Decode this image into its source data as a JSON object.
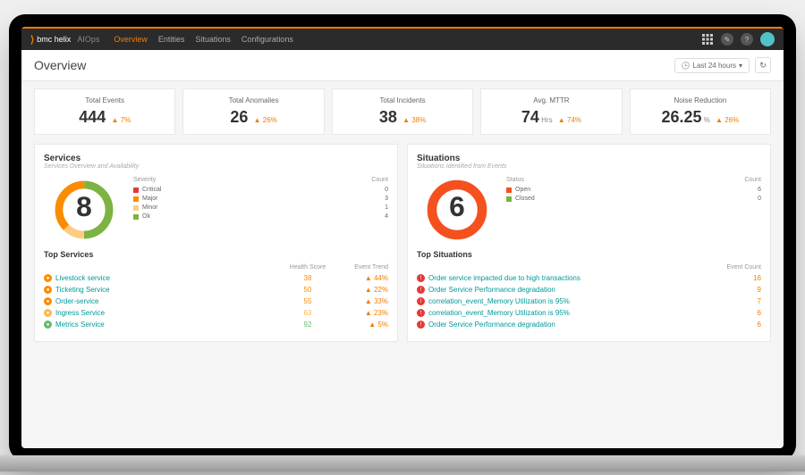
{
  "brand": {
    "logo": "⟩",
    "main": "bmc helix",
    "sub": "AIOps"
  },
  "nav": [
    {
      "label": "Overview",
      "active": true
    },
    {
      "label": "Entities",
      "active": false
    },
    {
      "label": "Situations",
      "active": false
    },
    {
      "label": "Configurations",
      "active": false
    }
  ],
  "page_title": "Overview",
  "time_filter": {
    "icon": "🕒",
    "label": "Last 24 hours",
    "caret": "▾"
  },
  "refresh_icon": "↻",
  "kpis": [
    {
      "label": "Total Events",
      "value": "444",
      "unit": "",
      "delta": "▲ 7%"
    },
    {
      "label": "Total Anomalies",
      "value": "26",
      "unit": "",
      "delta": "▲ 26%"
    },
    {
      "label": "Total Incidents",
      "value": "38",
      "unit": "",
      "delta": "▲ 38%"
    },
    {
      "label": "Avg. MTTR",
      "value": "74",
      "unit": "Hrs",
      "delta": "▲ 74%"
    },
    {
      "label": "Noise Reduction",
      "value": "26.25",
      "unit": "%",
      "delta": "▲ 26%"
    }
  ],
  "services": {
    "title": "Services",
    "subtitle": "Services Overview and Availability",
    "donut_center": "8",
    "legend_headers": {
      "left": "Severity",
      "right": "Count"
    },
    "legend": [
      {
        "label": "Critical",
        "count": "0",
        "color": "#e53935"
      },
      {
        "label": "Major",
        "count": "3",
        "color": "#fb8c00"
      },
      {
        "label": "Minor",
        "count": "1",
        "color": "#ffcc80"
      },
      {
        "label": "Ok",
        "count": "4",
        "color": "#7cb342"
      }
    ],
    "top_title": "Top Services",
    "columns": {
      "c1": "",
      "c2": "Health Score",
      "c3": "Event Trend"
    },
    "rows": [
      {
        "icon_color": "#fb8c00",
        "name": "Livestock service",
        "health": "38",
        "trend": "▲ 44%"
      },
      {
        "icon_color": "#fb8c00",
        "name": "Ticketing Service",
        "health": "50",
        "trend": "▲ 22%"
      },
      {
        "icon_color": "#fb8c00",
        "name": "Order-service",
        "health": "55",
        "trend": "▲ 33%"
      },
      {
        "icon_color": "#ffb74d",
        "name": "Ingress Service",
        "health": "63",
        "trend": "▲ 23%"
      },
      {
        "icon_color": "#66bb6a",
        "name": "Metrics Service",
        "health": "92",
        "trend": "▲ 5%"
      }
    ]
  },
  "situations": {
    "title": "Situations",
    "subtitle": "Situations Identified from Events",
    "donut_center": "6",
    "legend_headers": {
      "left": "Status",
      "right": "Count"
    },
    "legend": [
      {
        "label": "Open",
        "count": "6",
        "color": "#f4511e"
      },
      {
        "label": "Closed",
        "count": "0",
        "color": "#7cb342"
      }
    ],
    "top_title": "Top Situations",
    "columns": {
      "c1": "",
      "c2": "Event Count"
    },
    "rows": [
      {
        "icon_color": "#e53935",
        "name": "Order service impacted due to high transactions",
        "count": "16"
      },
      {
        "icon_color": "#e53935",
        "name": "Order Service Performance degradation",
        "count": "9"
      },
      {
        "icon_color": "#e53935",
        "name": "correlation_event_Memory Utilization is 95%",
        "count": "7"
      },
      {
        "icon_color": "#e53935",
        "name": "correlation_event_Memory Utilization is 95%",
        "count": "6"
      },
      {
        "icon_color": "#e53935",
        "name": "Order Service Performance degradation",
        "count": "6"
      }
    ]
  },
  "chart_data": [
    {
      "type": "pie",
      "title": "Services by Severity",
      "categories": [
        "Critical",
        "Major",
        "Minor",
        "Ok"
      ],
      "values": [
        0,
        3,
        1,
        4
      ],
      "colors": [
        "#e53935",
        "#fb8c00",
        "#ffcc80",
        "#7cb342"
      ]
    },
    {
      "type": "pie",
      "title": "Situations by Status",
      "categories": [
        "Open",
        "Closed"
      ],
      "values": [
        6,
        0
      ],
      "colors": [
        "#f4511e",
        "#7cb342"
      ]
    }
  ]
}
